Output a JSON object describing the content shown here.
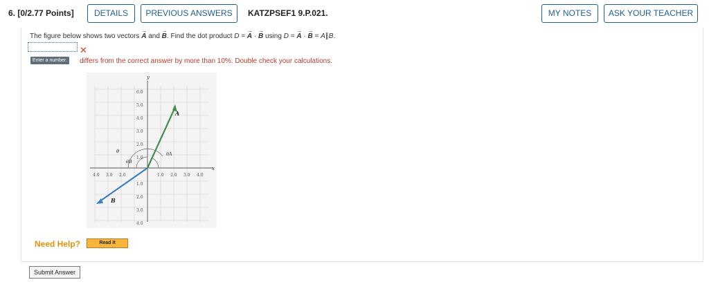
{
  "header": {
    "question_number": "6.",
    "points": "[0/2.77 Points]",
    "details_label": "DETAILS",
    "previous_answers_label": "PREVIOUS ANSWERS",
    "problem_code": "KATZPSEF1 9.P.021.",
    "my_notes_label": "MY NOTES",
    "ask_teacher_label": "ASK YOUR TEACHER"
  },
  "question": {
    "prefix": "The figure below shows two vectors",
    "vector_a": "A",
    "and": "and",
    "vector_b": "B",
    "mid": ". Find the dot product",
    "d1": "D",
    "eq1": "=",
    "a1": "A",
    "dot1": "·",
    "b1": "B",
    "using": "using",
    "d2": "D",
    "eq2": "=",
    "a2": "A",
    "dot2": "·",
    "b2": "B",
    "eq3": "=",
    "tail": "A",
    "parallel": "∥",
    "tail2": "B",
    "end": "."
  },
  "answer": {
    "value": "",
    "tooltip": "Enter a number.",
    "feedback": "differs from the correct answer by more than 10%. Double check your calculations."
  },
  "figure": {
    "y_axis_label": "y",
    "x_axis_label": "x",
    "y_ticks": [
      "6.0",
      "5.0",
      "4.0",
      "3.0",
      "2.0",
      "1.0",
      "1.0",
      "2.0",
      "3.0",
      "4.0"
    ],
    "x_ticks_neg": [
      "4.0",
      "3.0",
      "2.0"
    ],
    "x_ticks_pos": [
      "1.0",
      "2.0",
      "3.0",
      "4.0"
    ],
    "vector_a_label": "A",
    "vector_b_label": "B",
    "theta_label": "θ",
    "theta_a_label": "θA",
    "theta_b_label": "θB",
    "colors": {
      "vector_a": "#3f8f4f",
      "vector_b": "#3a7fc1",
      "grid": "#cfcfcf"
    }
  },
  "help": {
    "need_help_label": "Need Help?",
    "read_it_label": "Read It"
  },
  "submit_label": "Submit Answer"
}
